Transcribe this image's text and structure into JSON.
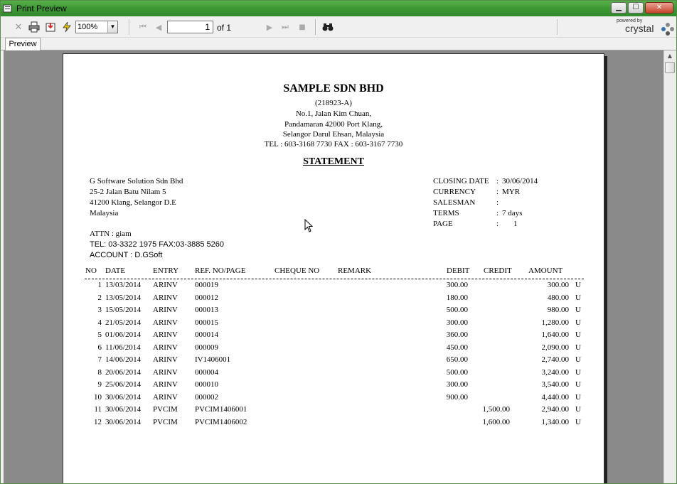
{
  "window": {
    "title": "Print Preview"
  },
  "toolbar": {
    "zoom": "100%",
    "page_value": "1",
    "page_of": "of 1"
  },
  "brand": {
    "powered_by": "powered by",
    "name": "crystal"
  },
  "tab": {
    "label": "Preview"
  },
  "report": {
    "company": "SAMPLE SDN BHD",
    "reg_no": "(218923-A)",
    "addr1": "No.1, Jalan Kim Chuan,",
    "addr2": "Pandamaran 42000 Port Klang,",
    "addr3": "Selangor Darul Ehsan, Malaysia",
    "contact": "TEL : 603-3168 7730 FAX : 603-3167 7730",
    "title": "STATEMENT",
    "customer": {
      "name": "G Software Solution Sdn Bhd",
      "line1": "25-2 Jalan Batu Nilam 5",
      "line2": "41200 Klang, Selangor D.E",
      "line3": "Malaysia",
      "attn": "ATTN : giam",
      "tel": "TEL: 03-3322 1975  FAX:03-3885 5260",
      "account": "ACCOUNT : D.GSoft"
    },
    "meta": {
      "closing_label": "CLOSING DATE",
      "closing_value": "30/06/2014",
      "currency_label": "CURRENCY",
      "currency_value": "MYR",
      "salesman_label": "SALESMAN",
      "salesman_value": "",
      "terms_label": "TERMS",
      "terms_value": "7 days",
      "page_label": "PAGE",
      "page_value": "1",
      "colon": ":"
    },
    "columns": {
      "no": "NO",
      "date": "DATE",
      "entry": "ENTRY",
      "ref": "REF. NO/PAGE",
      "cheque": "CHEQUE NO",
      "remark": "REMARK",
      "debit": "DEBIT",
      "credit": "CREDIT",
      "amount": "AMOUNT"
    },
    "rows": [
      {
        "no": "1",
        "date": "13/03/2014",
        "entry": "ARINV",
        "ref": "000019",
        "debit": "300.00",
        "credit": "",
        "amount": "300.00",
        "flag": "U"
      },
      {
        "no": "2",
        "date": "13/05/2014",
        "entry": "ARINV",
        "ref": "000012",
        "debit": "180.00",
        "credit": "",
        "amount": "480.00",
        "flag": "U"
      },
      {
        "no": "3",
        "date": "15/05/2014",
        "entry": "ARINV",
        "ref": "000013",
        "debit": "500.00",
        "credit": "",
        "amount": "980.00",
        "flag": "U"
      },
      {
        "no": "4",
        "date": "21/05/2014",
        "entry": "ARINV",
        "ref": "000015",
        "debit": "300.00",
        "credit": "",
        "amount": "1,280.00",
        "flag": "U"
      },
      {
        "no": "5",
        "date": "01/06/2014",
        "entry": "ARINV",
        "ref": "000014",
        "debit": "360.00",
        "credit": "",
        "amount": "1,640.00",
        "flag": "U"
      },
      {
        "no": "6",
        "date": "11/06/2014",
        "entry": "ARINV",
        "ref": "000009",
        "debit": "450.00",
        "credit": "",
        "amount": "2,090.00",
        "flag": "U"
      },
      {
        "no": "7",
        "date": "14/06/2014",
        "entry": "ARINV",
        "ref": "IV1406001",
        "debit": "650.00",
        "credit": "",
        "amount": "2,740.00",
        "flag": "U"
      },
      {
        "no": "8",
        "date": "20/06/2014",
        "entry": "ARINV",
        "ref": "000004",
        "debit": "500.00",
        "credit": "",
        "amount": "3,240.00",
        "flag": "U"
      },
      {
        "no": "9",
        "date": "25/06/2014",
        "entry": "ARINV",
        "ref": "000010",
        "debit": "300.00",
        "credit": "",
        "amount": "3,540.00",
        "flag": "U"
      },
      {
        "no": "10",
        "date": "30/06/2014",
        "entry": "ARINV",
        "ref": "000002",
        "debit": "900.00",
        "credit": "",
        "amount": "4,440.00",
        "flag": "U"
      },
      {
        "no": "11",
        "date": "30/06/2014",
        "entry": "PVCIM",
        "ref": "PVCIM1406001",
        "debit": "",
        "credit": "1,500.00",
        "amount": "2,940.00",
        "flag": "U"
      },
      {
        "no": "12",
        "date": "30/06/2014",
        "entry": "PVCIM",
        "ref": "PVCIM1406002",
        "debit": "",
        "credit": "1,600.00",
        "amount": "1,340.00",
        "flag": "U"
      }
    ]
  }
}
